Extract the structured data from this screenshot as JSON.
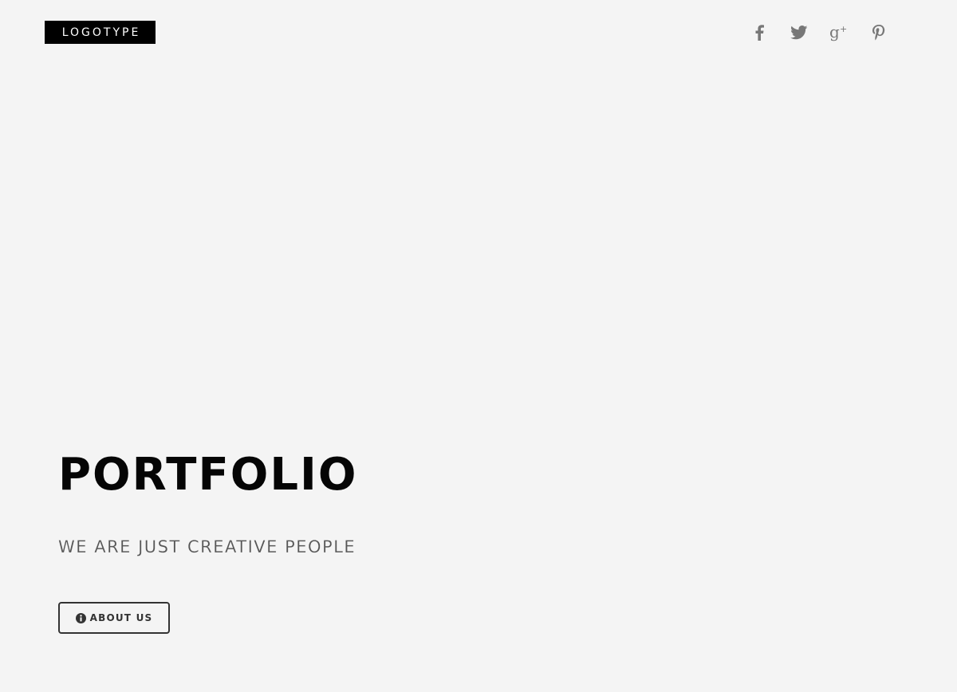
{
  "header": {
    "logo_text": "LOGOTYPE",
    "social_icons": [
      "facebook-icon",
      "twitter-icon",
      "google-plus-icon",
      "pinterest-icon"
    ]
  },
  "hero": {
    "title": "PORTFOLIO",
    "subtitle": "WE ARE JUST CREATIVE PEOPLE",
    "button_label": "ABOUT US",
    "button_icon": "info-icon"
  },
  "colors": {
    "background": "#f4f4f4",
    "logo_bg": "#000000",
    "title": "#050505",
    "icon": "#777777",
    "button_border": "#333333"
  }
}
